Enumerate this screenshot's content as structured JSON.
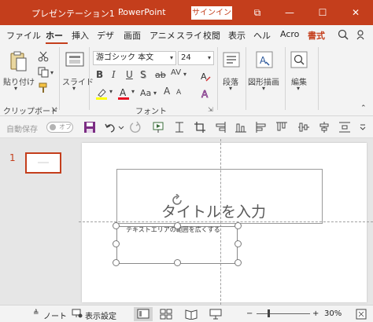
{
  "titlebar": {
    "doc_title": "プレゼンテーション1",
    "separator": "-",
    "app_name": "PowerPoint",
    "signin_label": "サインイン",
    "restore_glyph": "⧉",
    "minimize_glyph": "—",
    "maximize_glyph": "☐",
    "close_glyph": "✕"
  },
  "tabs": [
    {
      "label": "ファイル"
    },
    {
      "label": "ホーム",
      "display": "ホー"
    },
    {
      "label": "挿入"
    },
    {
      "label": "デザ"
    },
    {
      "label": "画面"
    },
    {
      "label": "アニメ"
    },
    {
      "label": "スライ"
    },
    {
      "label": "校閲"
    },
    {
      "label": "表示"
    },
    {
      "label": "ヘル"
    },
    {
      "label": "Acro"
    },
    {
      "label": "書式"
    }
  ],
  "ribbon": {
    "paste_label": "貼り付け",
    "clipboard_group": "クリップボード",
    "slides_label": "スライド",
    "font_name": "游ゴシック 本文",
    "font_size": "24",
    "font_group": "フォント",
    "bold": "B",
    "italic": "I",
    "underline": "U",
    "shadow": "S",
    "strike": "ab",
    "spacing": "AV",
    "case": "Aa",
    "grow": "A",
    "shrink": "A",
    "paragraph_label": "段落",
    "drawing_label": "図形描画",
    "editing_label": "編集"
  },
  "qat": {
    "autosave_label": "自動保存",
    "autosave_state": "オフ"
  },
  "thumbnails": [
    {
      "number": "1"
    }
  ],
  "slide": {
    "title_placeholder": "タイトルを入力",
    "body_text": "テキストエリアの範囲を広くする"
  },
  "statusbar": {
    "notes_label": "ノート",
    "display_settings_label": "表示設定",
    "zoom_minus": "−",
    "zoom_plus": "+",
    "zoom_level": "30%"
  },
  "colors": {
    "accent": "#c43e1c",
    "ribbon_bg": "#f3f3f3",
    "workspace_bg": "#e6e6e6",
    "font_color_red": "#e81123",
    "highlight_yellow": "#ffff00",
    "save_icon_purple": "#7b2c83"
  }
}
